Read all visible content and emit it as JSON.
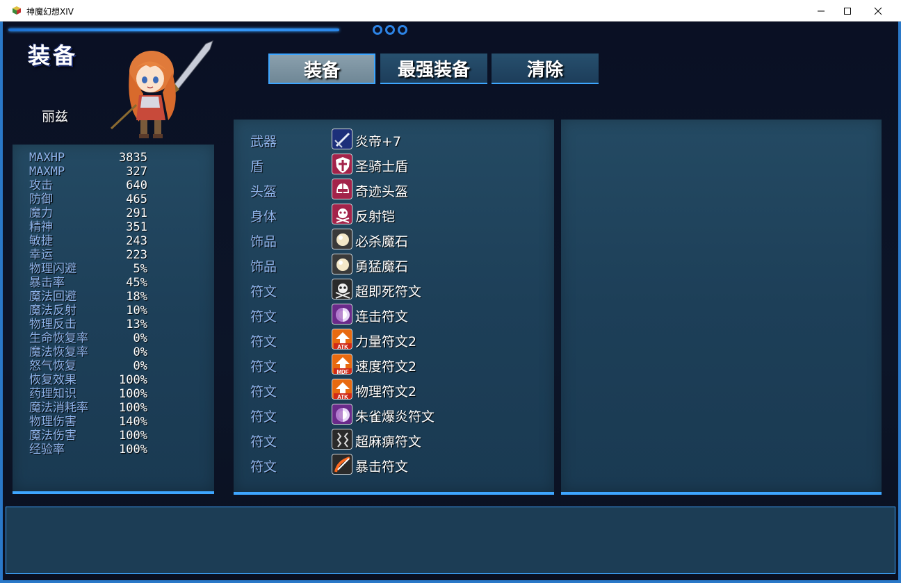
{
  "window": {
    "title": "神魔幻想XIV",
    "icons": {
      "app": "game-cube-icon",
      "minimize": "minimize-icon",
      "maximize": "maximize-icon",
      "close": "close-icon"
    }
  },
  "scene": {
    "title": "装备"
  },
  "actor": {
    "name": "丽兹"
  },
  "commands": {
    "equip": "装备",
    "optimize": "最强装备",
    "clear": "清除",
    "active": "equip"
  },
  "stats": [
    {
      "label": "MAXHP",
      "value": "3835"
    },
    {
      "label": "MAXMP",
      "value": "327"
    },
    {
      "label": "攻击",
      "value": "640"
    },
    {
      "label": "防御",
      "value": "465"
    },
    {
      "label": "魔力",
      "value": "291"
    },
    {
      "label": "精神",
      "value": "351"
    },
    {
      "label": "敏捷",
      "value": "243"
    },
    {
      "label": "幸运",
      "value": "223"
    },
    {
      "label": "物理闪避",
      "value": "5%"
    },
    {
      "label": "暴击率",
      "value": "45%"
    },
    {
      "label": "魔法回避",
      "value": "18%"
    },
    {
      "label": "魔法反射",
      "value": "10%"
    },
    {
      "label": "物理反击",
      "value": "13%"
    },
    {
      "label": "生命恢复率",
      "value": "0%"
    },
    {
      "label": "魔法恢复率",
      "value": "0%"
    },
    {
      "label": "怒气恢复",
      "value": "0%"
    },
    {
      "label": "恢复效果",
      "value": "100%"
    },
    {
      "label": "药理知识",
      "value": "100%"
    },
    {
      "label": "魔法消耗率",
      "value": "100%"
    },
    {
      "label": "物理伤害",
      "value": "140%"
    },
    {
      "label": "魔法伤害",
      "value": "100%"
    },
    {
      "label": "经验率",
      "value": "100%"
    }
  ],
  "slots": [
    {
      "label": "武器",
      "item": "炎帝+7",
      "icon": "sword-icon",
      "icon_bg": "#1c2f7a"
    },
    {
      "label": "盾",
      "item": "圣骑士盾",
      "icon": "shield-icon",
      "icon_bg": "#a3234a"
    },
    {
      "label": "头盔",
      "item": "奇迹头盔",
      "icon": "helmet-icon",
      "icon_bg": "#a3234a"
    },
    {
      "label": "身体",
      "item": "反射铠",
      "icon": "armor-icon",
      "icon_bg": "#a3234a"
    },
    {
      "label": "饰品",
      "item": "必杀魔石",
      "icon": "orb-icon",
      "icon_bg": "#3a3a3a"
    },
    {
      "label": "饰品",
      "item": "勇猛魔石",
      "icon": "orb-icon",
      "icon_bg": "#3a3a3a"
    },
    {
      "label": "符文",
      "item": "超即死符文",
      "icon": "skull-icon",
      "icon_bg": "#2a2a2a"
    },
    {
      "label": "符文",
      "item": "连击符文",
      "icon": "purple-orb-icon",
      "icon_bg": "#6a2a8a"
    },
    {
      "label": "符文",
      "item": "力量符文2",
      "icon": "atk-up-icon",
      "icon_bg": "#e86a10",
      "icon_text": "ATK"
    },
    {
      "label": "符文",
      "item": "速度符文2",
      "icon": "mdf-up-icon",
      "icon_bg": "#e86a10",
      "icon_text": "MDF"
    },
    {
      "label": "符文",
      "item": "物理符文2",
      "icon": "atk-up-icon",
      "icon_bg": "#e86a10",
      "icon_text": "ATK"
    },
    {
      "label": "符文",
      "item": "朱雀爆炎符文",
      "icon": "purple-orb-icon",
      "icon_bg": "#6a2a8a"
    },
    {
      "label": "符文",
      "item": "超麻痹符文",
      "icon": "paralysis-icon",
      "icon_bg": "#2a2a2a"
    },
    {
      "label": "符文",
      "item": "暴击符文",
      "icon": "critical-slash-icon",
      "icon_bg": "#2a2a2a"
    }
  ],
  "colors": {
    "accent": "#3ea6ff",
    "label": "#8fb3ea",
    "panel": "#1f4360"
  }
}
